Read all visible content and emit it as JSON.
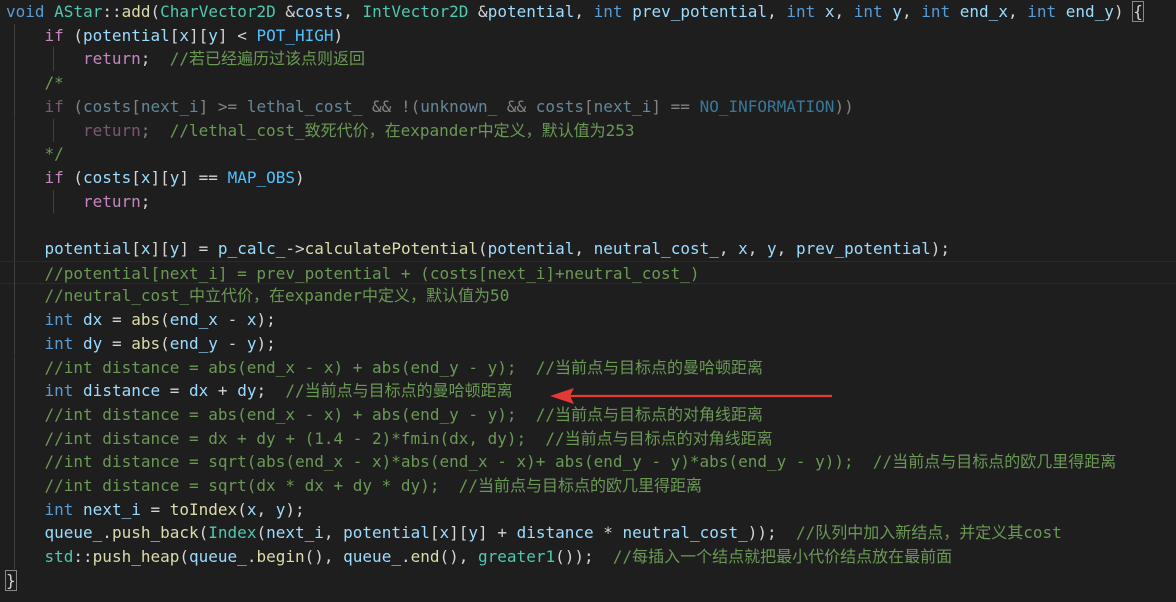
{
  "colors": {
    "background": "#1e1e1e",
    "keyword": "#569cd6",
    "comment": "#6a9955",
    "function": "#dcdcaa",
    "type": "#4ec9b0",
    "variable": "#9cdcfe",
    "macro": "#4fc1ff",
    "number": "#b5cea8",
    "plain": "#d4d4d4",
    "annotation_arrow": "#e53935"
  },
  "annotation": {
    "arrow_target_line": 16
  },
  "lines": [
    {
      "indent": 0,
      "tokens": [
        [
          "k",
          "void"
        ],
        [
          "p",
          " "
        ],
        [
          "t",
          "AStar"
        ],
        [
          "p",
          "::"
        ],
        [
          "f",
          "add"
        ],
        [
          "p",
          "("
        ],
        [
          "t",
          "CharVector2D"
        ],
        [
          "p",
          " &"
        ],
        [
          "v",
          "costs"
        ],
        [
          "p",
          ", "
        ],
        [
          "t",
          "IntVector2D"
        ],
        [
          "p",
          " &"
        ],
        [
          "v",
          "potential"
        ],
        [
          "p",
          ", "
        ],
        [
          "k",
          "int"
        ],
        [
          "p",
          " "
        ],
        [
          "v",
          "prev_potential"
        ],
        [
          "p",
          ", "
        ],
        [
          "k",
          "int"
        ],
        [
          "p",
          " "
        ],
        [
          "v",
          "x"
        ],
        [
          "p",
          ", "
        ],
        [
          "k",
          "int"
        ],
        [
          "p",
          " "
        ],
        [
          "v",
          "y"
        ],
        [
          "p",
          ", "
        ],
        [
          "k",
          "int"
        ],
        [
          "p",
          " "
        ],
        [
          "v",
          "end_x"
        ],
        [
          "p",
          ", "
        ],
        [
          "k",
          "int"
        ],
        [
          "p",
          " "
        ],
        [
          "v",
          "end_y"
        ],
        [
          "p",
          ") "
        ],
        [
          "b",
          "{"
        ]
      ]
    },
    {
      "indent": 1,
      "tokens": [
        [
          "pk",
          "if"
        ],
        [
          "p",
          " ("
        ],
        [
          "v",
          "potential"
        ],
        [
          "p",
          "["
        ],
        [
          "v",
          "x"
        ],
        [
          "p",
          "]["
        ],
        [
          "v",
          "y"
        ],
        [
          "p",
          "] < "
        ],
        [
          "m",
          "POT_HIGH"
        ],
        [
          "p",
          ")"
        ]
      ]
    },
    {
      "indent": 2,
      "tokens": [
        [
          "pk",
          "return"
        ],
        [
          "p",
          ";  "
        ],
        [
          "c",
          "//若已经遍历过该点则返回"
        ]
      ]
    },
    {
      "indent": 1,
      "tokens": [
        [
          "c",
          "/*"
        ]
      ]
    },
    {
      "indent": 1,
      "dim": true,
      "tokens": [
        [
          "pk",
          "if"
        ],
        [
          "p",
          " ("
        ],
        [
          "v",
          "costs"
        ],
        [
          "p",
          "["
        ],
        [
          "v",
          "next_i"
        ],
        [
          "p",
          "] >= "
        ],
        [
          "v",
          "lethal_cost_"
        ],
        [
          "p",
          " && !("
        ],
        [
          "v",
          "unknown_"
        ],
        [
          "p",
          " && "
        ],
        [
          "v",
          "costs"
        ],
        [
          "p",
          "["
        ],
        [
          "v",
          "next_i"
        ],
        [
          "p",
          "] == "
        ],
        [
          "m",
          "NO_INFORMATION"
        ],
        [
          "p",
          "))"
        ]
      ]
    },
    {
      "indent": 2,
      "dim": true,
      "tokens": [
        [
          "pk",
          "return"
        ],
        [
          "p",
          ";  "
        ],
        [
          "c",
          "//lethal_cost_致死代价，在expander中定义，默认值为253"
        ]
      ]
    },
    {
      "indent": 1,
      "tokens": [
        [
          "c",
          "*/"
        ]
      ]
    },
    {
      "indent": 1,
      "tokens": [
        [
          "pk",
          "if"
        ],
        [
          "p",
          " ("
        ],
        [
          "v",
          "costs"
        ],
        [
          "p",
          "["
        ],
        [
          "v",
          "x"
        ],
        [
          "p",
          "]["
        ],
        [
          "v",
          "y"
        ],
        [
          "p",
          "] == "
        ],
        [
          "m",
          "MAP_OBS"
        ],
        [
          "p",
          ")"
        ]
      ]
    },
    {
      "indent": 2,
      "tokens": [
        [
          "pk",
          "return"
        ],
        [
          "p",
          ";"
        ]
      ]
    },
    {
      "indent": 1,
      "tokens": []
    },
    {
      "indent": 1,
      "tokens": [
        [
          "v",
          "potential"
        ],
        [
          "p",
          "["
        ],
        [
          "v",
          "x"
        ],
        [
          "p",
          "]["
        ],
        [
          "v",
          "y"
        ],
        [
          "p",
          "] = "
        ],
        [
          "v",
          "p_calc_"
        ],
        [
          "p",
          "->"
        ],
        [
          "f",
          "calculatePotential"
        ],
        [
          "p",
          "("
        ],
        [
          "v",
          "potential"
        ],
        [
          "p",
          ", "
        ],
        [
          "v",
          "neutral_cost_"
        ],
        [
          "p",
          ", "
        ],
        [
          "v",
          "x"
        ],
        [
          "p",
          ", "
        ],
        [
          "v",
          "y"
        ],
        [
          "p",
          ", "
        ],
        [
          "v",
          "prev_potential"
        ],
        [
          "p",
          ");"
        ]
      ]
    },
    {
      "indent": 1,
      "current": true,
      "tokens": [
        [
          "c",
          "//potential[next_i] = prev_potential + (costs[next_i]+neutral_cost_)"
        ]
      ]
    },
    {
      "indent": 1,
      "tokens": [
        [
          "c",
          "//neutral_cost_中立代价，在expander中定义，默认值为50"
        ]
      ]
    },
    {
      "indent": 1,
      "tokens": [
        [
          "k",
          "int"
        ],
        [
          "p",
          " "
        ],
        [
          "v",
          "dx"
        ],
        [
          "p",
          " = "
        ],
        [
          "f",
          "abs"
        ],
        [
          "p",
          "("
        ],
        [
          "v",
          "end_x"
        ],
        [
          "p",
          " - "
        ],
        [
          "v",
          "x"
        ],
        [
          "p",
          ");"
        ]
      ]
    },
    {
      "indent": 1,
      "tokens": [
        [
          "k",
          "int"
        ],
        [
          "p",
          " "
        ],
        [
          "v",
          "dy"
        ],
        [
          "p",
          " = "
        ],
        [
          "f",
          "abs"
        ],
        [
          "p",
          "("
        ],
        [
          "v",
          "end_y"
        ],
        [
          "p",
          " - "
        ],
        [
          "v",
          "y"
        ],
        [
          "p",
          ");"
        ]
      ]
    },
    {
      "indent": 1,
      "tokens": [
        [
          "c",
          "//int distance = abs(end_x - x) + abs(end_y - y);  //当前点与目标点的曼哈顿距离"
        ]
      ]
    },
    {
      "indent": 1,
      "tokens": [
        [
          "k",
          "int"
        ],
        [
          "p",
          " "
        ],
        [
          "v",
          "distance"
        ],
        [
          "p",
          " = "
        ],
        [
          "v",
          "dx"
        ],
        [
          "p",
          " + "
        ],
        [
          "v",
          "dy"
        ],
        [
          "p",
          ";  "
        ],
        [
          "c",
          "//当前点与目标点的曼哈顿距离"
        ]
      ]
    },
    {
      "indent": 1,
      "tokens": [
        [
          "c",
          "//int distance = abs(end_x - x) + abs(end_y - y);  //当前点与目标点的对角线距离"
        ]
      ]
    },
    {
      "indent": 1,
      "tokens": [
        [
          "c",
          "//int distance = dx + dy + (1.4 - 2)*fmin(dx, dy);  //当前点与目标点的对角线距离"
        ]
      ]
    },
    {
      "indent": 1,
      "tokens": [
        [
          "c",
          "//int distance = sqrt(abs(end_x - x)*abs(end_x - x)+ abs(end_y - y)*abs(end_y - y));  //当前点与目标点的欧几里得距离"
        ]
      ]
    },
    {
      "indent": 1,
      "tokens": [
        [
          "c",
          "//int distance = sqrt(dx * dx + dy * dy);  //当前点与目标点的欧几里得距离"
        ]
      ]
    },
    {
      "indent": 1,
      "tokens": [
        [
          "k",
          "int"
        ],
        [
          "p",
          " "
        ],
        [
          "v",
          "next_i"
        ],
        [
          "p",
          " = "
        ],
        [
          "f",
          "toIndex"
        ],
        [
          "p",
          "("
        ],
        [
          "v",
          "x"
        ],
        [
          "p",
          ", "
        ],
        [
          "v",
          "y"
        ],
        [
          "p",
          ");"
        ]
      ]
    },
    {
      "indent": 1,
      "tokens": [
        [
          "v",
          "queue_"
        ],
        [
          "p",
          "."
        ],
        [
          "f",
          "push_back"
        ],
        [
          "p",
          "("
        ],
        [
          "t",
          "Index"
        ],
        [
          "p",
          "("
        ],
        [
          "v",
          "next_i"
        ],
        [
          "p",
          ", "
        ],
        [
          "v",
          "potential"
        ],
        [
          "p",
          "["
        ],
        [
          "v",
          "x"
        ],
        [
          "p",
          "]["
        ],
        [
          "v",
          "y"
        ],
        [
          "p",
          "] + "
        ],
        [
          "v",
          "distance"
        ],
        [
          "p",
          " * "
        ],
        [
          "v",
          "neutral_cost_"
        ],
        [
          "p",
          "));  "
        ],
        [
          "c",
          "//队列中加入新结点，并定义其cost"
        ]
      ]
    },
    {
      "indent": 1,
      "tokens": [
        [
          "t",
          "std"
        ],
        [
          "p",
          "::"
        ],
        [
          "f",
          "push_heap"
        ],
        [
          "p",
          "("
        ],
        [
          "v",
          "queue_"
        ],
        [
          "p",
          "."
        ],
        [
          "f",
          "begin"
        ],
        [
          "p",
          "(), "
        ],
        [
          "v",
          "queue_"
        ],
        [
          "p",
          "."
        ],
        [
          "f",
          "end"
        ],
        [
          "p",
          "(), "
        ],
        [
          "t",
          "greater1"
        ],
        [
          "p",
          "());  "
        ],
        [
          "c",
          "//每插入一个结点就把最小代价结点放在最前面"
        ]
      ]
    },
    {
      "indent": 0,
      "tokens": [
        [
          "b",
          "}"
        ]
      ]
    }
  ]
}
